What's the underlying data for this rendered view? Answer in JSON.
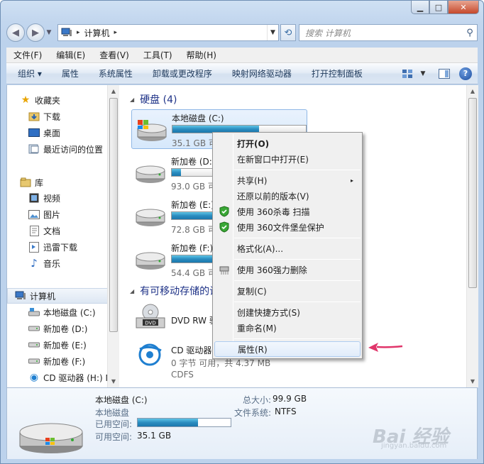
{
  "window": {
    "caption": {
      "minimize": "▁",
      "maximize": "□",
      "close": "✕"
    }
  },
  "address": {
    "root_sep": "▸",
    "path": "计算机",
    "path_sep": "▸"
  },
  "search": {
    "placeholder": "搜索 计算机"
  },
  "menubar": [
    "文件(F)",
    "编辑(E)",
    "查看(V)",
    "工具(T)",
    "帮助(H)"
  ],
  "toolbar": {
    "organize": "组织 ▾",
    "items": [
      "属性",
      "系统属性",
      "卸载或更改程序",
      "映射网络驱动器",
      "打开控制面板"
    ],
    "help": "?"
  },
  "nav": {
    "favorites": "收藏夹",
    "downloads": "下载",
    "desktop": "桌面",
    "recent": "最近访问的位置",
    "libraries": "库",
    "videos": "视频",
    "pictures": "图片",
    "documents": "文档",
    "xunlei": "迅雷下载",
    "music": "音乐",
    "computer": "计算机",
    "drive_c": "本地磁盘 (C:)",
    "drive_d": "新加卷 (D:)",
    "drive_e": "新加卷 (E:)",
    "drive_f": "新加卷 (F:)",
    "drive_h": "CD 驱动器 (H:) M"
  },
  "groups": {
    "hdd": "硬盘 (4)",
    "removable": "有可移动存储的设"
  },
  "drives": [
    {
      "name": "本地磁盘 (C:)",
      "free": "35.1 GB 可用，共 99.9 GB",
      "used_fraction": 0.65
    },
    {
      "name": "新加卷 (D:)",
      "free": "93.0 GB 可",
      "used_fraction": 0.07
    },
    {
      "name": "新加卷 (E:)",
      "free": "72.8 GB 可",
      "used_fraction": 0.45
    },
    {
      "name": "新加卷 (F:)",
      "free": "54.4 GB 可",
      "used_fraction": 0.62
    },
    {
      "name": "DVD RW 驱"
    },
    {
      "name": "CD 驱动器",
      "free": "0 字节 可用，共 4.37 MB",
      "fs": "CDFS"
    }
  ],
  "context_menu": {
    "open": "打开(O)",
    "open_new_window": "在新窗口中打开(E)",
    "share": "共享(H)",
    "restore": "还原以前的版本(V)",
    "scan360": "使用 360杀毒 扫描",
    "protect360": "使用 360文件堡垒保护",
    "format": "格式化(A)...",
    "delete360": "使用 360强力删除",
    "copy": "复制(C)",
    "shortcut": "创建快捷方式(S)",
    "rename": "重命名(M)",
    "properties": "属性(R)",
    "submenu_arrow": "▸"
  },
  "details": {
    "name": "本地磁盘 (C:)",
    "type": "本地磁盘",
    "used_label": "已用空间:",
    "free_label": "可用空间:",
    "free_value": "35.1 GB",
    "total_label": "总大小:",
    "total_value": "99.9 GB",
    "fs_label": "文件系统:",
    "fs_value": "NTFS",
    "used_fraction": 0.65
  },
  "watermark": {
    "brand": "Bai 经验",
    "url": "jingyan.baidu.com"
  },
  "colors": {
    "accent": "#2b8dc0",
    "group_heading": "#1e3287",
    "arrow": "#e0356a"
  }
}
